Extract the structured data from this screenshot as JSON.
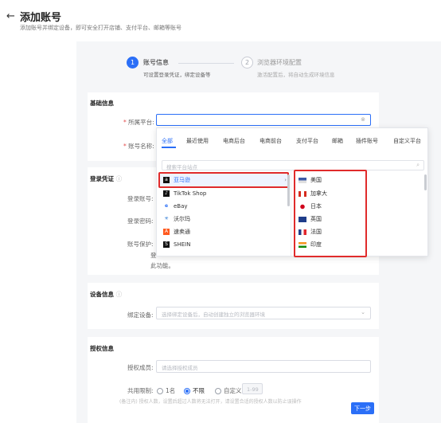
{
  "header": {
    "back_icon": "arrow-left-icon",
    "title": "添加账号",
    "subtitle": "添加账号并绑定设备，即可安全打开店铺、支付平台、邮箱等账号"
  },
  "steps": [
    {
      "number": "1",
      "title": "账号信息",
      "desc": "可设置登录凭证，绑定设备等"
    },
    {
      "number": "2",
      "title": "浏览器环境配置",
      "desc": "激活配置后，将自动生成环境信息"
    }
  ],
  "basic_info": {
    "title": "基础信息",
    "platform_label": "所属平台:",
    "account_name_label": "账号名称:"
  },
  "dropdown": {
    "tabs": [
      "全部",
      "最近使用",
      "电商后台",
      "电商前台",
      "支付平台",
      "邮箱",
      "插件账号",
      "自定义平台"
    ],
    "active_tab": "全部",
    "search_placeholder": "搜索平台站点",
    "platforms": [
      {
        "name": "亚马逊",
        "icon": "amazon-icon",
        "color": "#111111"
      },
      {
        "name": "TikTok Shop",
        "icon": "tiktok-icon",
        "color": "#111111"
      },
      {
        "name": "eBay",
        "icon": "ebay-icon",
        "color": "#2b6ff7"
      },
      {
        "name": "沃尔玛",
        "icon": "walmart-icon",
        "color": "#1d6fd1"
      },
      {
        "name": "速卖通",
        "icon": "aliexpress-icon",
        "color": "#ff5a1f"
      },
      {
        "name": "SHEIN",
        "icon": "shein-icon",
        "color": "#111111"
      }
    ],
    "chevron_icon": "chevron-right-icon",
    "countries": [
      {
        "name": "美国",
        "flag": "us-flag-icon"
      },
      {
        "name": "加拿大",
        "flag": "canada-flag-icon"
      },
      {
        "name": "日本",
        "flag": "japan-flag-icon"
      },
      {
        "name": "英国",
        "flag": "uk-flag-icon"
      },
      {
        "name": "法国",
        "flag": "france-flag-icon"
      },
      {
        "name": "印度",
        "flag": "india-flag-icon"
      }
    ]
  },
  "login_credentials": {
    "title": "登录凭证",
    "info_icon": "info-icon",
    "login_account_label": "登录账号:",
    "login_password_label": "登录密码:",
    "account_protection_label": "账号保护:",
    "protection_text_1": "登",
    "protection_text_2": "此功能。"
  },
  "device_info": {
    "title": "设备信息",
    "info_icon": "info-icon",
    "bind_label": "绑定设备:",
    "bind_placeholder": "选择绑定设备后，自动创建独立的浏览器环境"
  },
  "auth_info": {
    "title": "授权信息",
    "members_label": "授权成员:",
    "members_placeholder": "请选择授权成员",
    "share_label": "共用限制:",
    "share_options": [
      "1名",
      "不限",
      "自定义"
    ],
    "share_selected": "不限",
    "custom_placeholder": "1-99",
    "note_prefix": "(备注内)",
    "note_text": "授权人数，设置后超过人数将无法打开，请设置合适的授权人数以防止误操作"
  },
  "footer": {
    "next_label": "下一步"
  },
  "colors": {
    "accent": "#2b6ff7",
    "highlight": "#e02b2b"
  }
}
